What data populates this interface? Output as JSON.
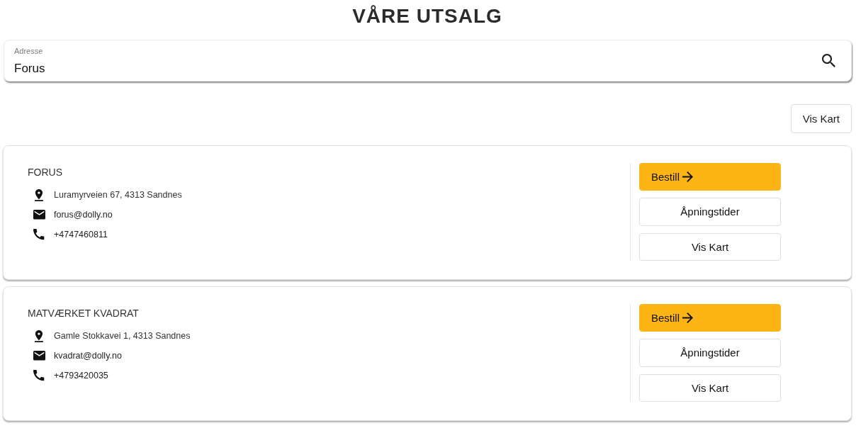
{
  "title": "VÅRE UTSALG",
  "search": {
    "label": "Adresse",
    "value": "Forus"
  },
  "map_button": "Vis Kart",
  "stores": [
    {
      "name": "FORUS",
      "details": [
        {
          "kind": "address",
          "text": "Luramyrveien 67, 4313 Sandnes"
        },
        {
          "kind": "email",
          "text": "forus@dolly.no"
        },
        {
          "kind": "phone",
          "text": "+4747460811"
        }
      ],
      "actions": [
        {
          "kind": "order",
          "label": "Bestill"
        },
        {
          "kind": "hours",
          "label": "Åpningstider"
        },
        {
          "kind": "map",
          "label": "Vis Kart"
        }
      ]
    },
    {
      "name": "MATVÆRKET KVADRAT",
      "details": [
        {
          "kind": "address",
          "text": "Gamle Stokkavei 1, 4313 Sandnes"
        },
        {
          "kind": "email",
          "text": "kvadrat@dolly.no"
        },
        {
          "kind": "phone",
          "text": "+4793420035"
        }
      ],
      "actions": [
        {
          "kind": "order",
          "label": "Bestill"
        },
        {
          "kind": "hours",
          "label": "Åpningstider"
        },
        {
          "kind": "map",
          "label": "Vis Kart"
        }
      ]
    }
  ]
}
